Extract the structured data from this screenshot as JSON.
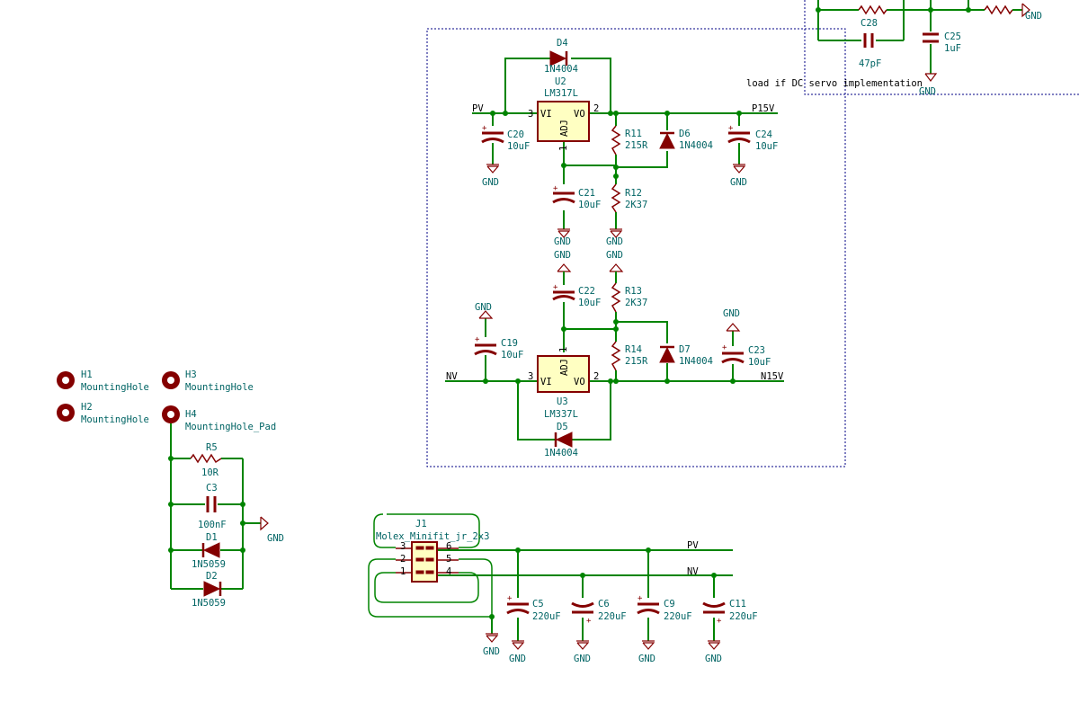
{
  "refs": {
    "J1": "J1",
    "C5": "C5",
    "C6": "C6",
    "C9": "C9",
    "C11": "C11",
    "C19": "C19",
    "C20": "C20",
    "C21": "C21",
    "C22": "C22",
    "C23": "C23",
    "C24": "C24",
    "C25": "C25",
    "C28": "C28",
    "C3": "C3",
    "R5": "R5",
    "R11": "R11",
    "R12": "R12",
    "R13": "R13",
    "R14": "R14",
    "D1": "D1",
    "D2": "D2",
    "D4": "D4",
    "D5": "D5",
    "D6": "D6",
    "D7": "D7",
    "U2": "U2",
    "U3": "U3",
    "H1": "H1",
    "H2": "H2",
    "H3": "H3",
    "H4": "H4"
  },
  "values": {
    "J1": "Molex_Minifit_jr_2x3",
    "C5": "220uF",
    "C6": "220uF",
    "C9": "220uF",
    "C11": "220uF",
    "C19": "10uF",
    "C20": "10uF",
    "C21": "10uF",
    "C22": "10uF",
    "C23": "10uF",
    "C24": "10uF",
    "C25": "1uF",
    "C28": "47pF",
    "C3": "100nF",
    "R5": "10R",
    "R11": "215R",
    "R12": "2K37",
    "R13": "2K37",
    "R14": "215R",
    "D1": "1N5059",
    "D2": "1N5059",
    "D4": "1N4004",
    "D5": "1N4004",
    "D6": "1N4004",
    "D7": "1N4004",
    "U2": "LM317L",
    "U3": "LM337L",
    "H1": "MountingHole",
    "H2": "MountingHole",
    "H3": "MountingHole",
    "H4": "MountingHole_Pad"
  },
  "nets": {
    "pv": "PV",
    "nv": "NV",
    "p15v": "P15V",
    "n15v": "N15V",
    "gnd": "GND"
  },
  "pins": {
    "vi": "VI",
    "vo": "VO",
    "adj": "ADJ",
    "n1": "1",
    "n2": "2",
    "n3": "3",
    "n4": "4",
    "n5": "5",
    "n6": "6",
    "plus": "+"
  },
  "notes": {
    "servo": "load if DC servo implementation"
  }
}
